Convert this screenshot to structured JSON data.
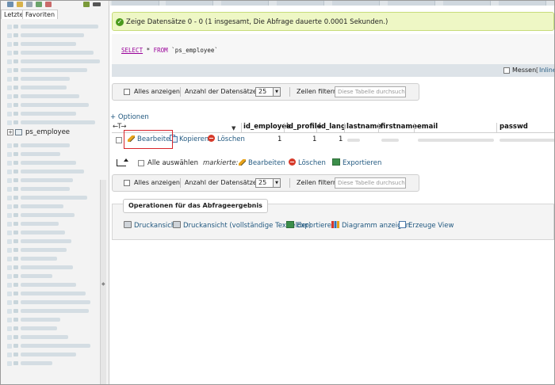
{
  "sidebar": {
    "tabs": [
      "Letzte",
      "Favoriten"
    ],
    "selected_table": "ps_employee",
    "expander": "+"
  },
  "success_message": "Zeige Datensätze 0 - 0 (1 insgesamt, Die Abfrage dauerte 0.0001 Sekunden.)",
  "sql": {
    "select_kw": "SELECT",
    "star": "*",
    "from_kw": "FROM",
    "table": "`ps_employee`"
  },
  "sqlbar": {
    "profile_label": "Messen",
    "separator": "[",
    "inline_label": "Inline"
  },
  "nav": {
    "show_all": "Alles anzeigen",
    "rows_label": "Anzahl der Datensätze:",
    "rows_value": "25",
    "filter_label": "Zeilen filtern:",
    "filter_placeholder": "Diese Tabelle durchsuchen"
  },
  "table": {
    "options_link": "+ Optionen",
    "arrows": "←T→",
    "sort_icon": "▼",
    "columns": [
      "id_employee",
      "id_profile",
      "id_lang",
      "lastname",
      "firstname",
      "email",
      "passwd"
    ],
    "row": {
      "edit": "Bearbeiten",
      "copy": "Kopieren",
      "delete": "Löschen",
      "id_employee": "1",
      "id_profile": "1",
      "id_lang": "1"
    }
  },
  "bulk": {
    "select_all": "Alle auswählen",
    "marked": "markierte:",
    "edit": "Bearbeiten",
    "delete": "Löschen",
    "export": "Exportieren"
  },
  "operations": {
    "legend": "Operationen für das Abfrageergebnis",
    "print": "Druckansicht",
    "print_full": "Druckansicht (vollständige Textfelder)",
    "export": "Exportieren",
    "chart": "Diagramm anzeigen",
    "view": "Erzeuge View"
  }
}
